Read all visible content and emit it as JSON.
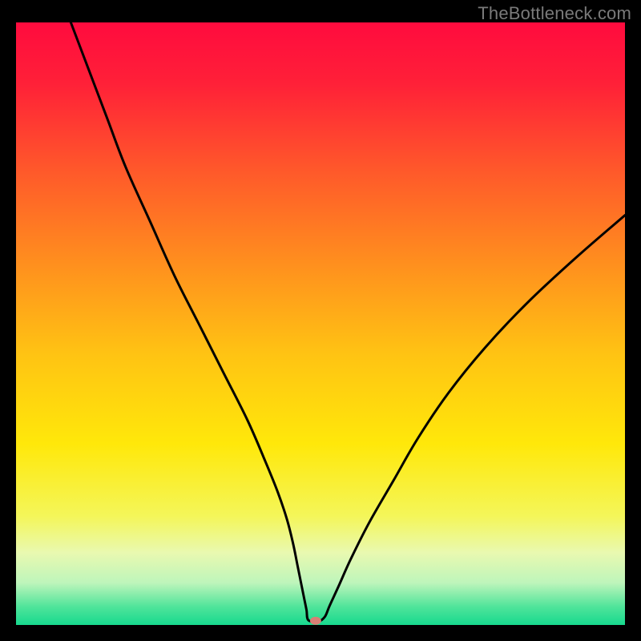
{
  "watermark": "TheBottleneck.com",
  "chart_data": {
    "type": "line",
    "title": "",
    "xlabel": "",
    "ylabel": "",
    "xlim": [
      0,
      100
    ],
    "ylim": [
      0,
      100
    ],
    "grid": false,
    "legend": false,
    "background_gradient": {
      "stops": [
        {
          "offset": 0.0,
          "color": "#ff0b3e"
        },
        {
          "offset": 0.1,
          "color": "#ff2038"
        },
        {
          "offset": 0.25,
          "color": "#ff5a2a"
        },
        {
          "offset": 0.4,
          "color": "#ff8f1e"
        },
        {
          "offset": 0.55,
          "color": "#ffc313"
        },
        {
          "offset": 0.7,
          "color": "#ffe80a"
        },
        {
          "offset": 0.82,
          "color": "#f4f65a"
        },
        {
          "offset": 0.88,
          "color": "#e9f9b0"
        },
        {
          "offset": 0.93,
          "color": "#bef5bb"
        },
        {
          "offset": 0.97,
          "color": "#4fe49a"
        },
        {
          "offset": 1.0,
          "color": "#17d98e"
        }
      ]
    },
    "series": [
      {
        "name": "bottleneck-curve",
        "color": "#000000",
        "x": [
          9,
          12,
          15,
          18,
          22,
          26,
          30,
          34,
          38,
          41,
          43,
          44.5,
          45.5,
          46.2,
          46.8,
          47.3,
          47.7,
          48.0,
          49.5,
          50.0,
          50.8,
          51.5,
          53,
          55,
          58,
          62,
          66,
          71,
          77,
          84,
          92,
          100
        ],
        "y": [
          100,
          92,
          84,
          76,
          67,
          58,
          50,
          42,
          34,
          27,
          22,
          17.5,
          13.5,
          10,
          7,
          4.5,
          2.5,
          0.8,
          0.6,
          0.7,
          1.5,
          3.2,
          6.5,
          11,
          17,
          24,
          31,
          38.5,
          46,
          53.5,
          61,
          68
        ]
      }
    ],
    "marker": {
      "name": "optimal-point",
      "x": 49.2,
      "y": 0.7,
      "color": "#d87f75",
      "rx": 7,
      "ry": 5
    }
  }
}
